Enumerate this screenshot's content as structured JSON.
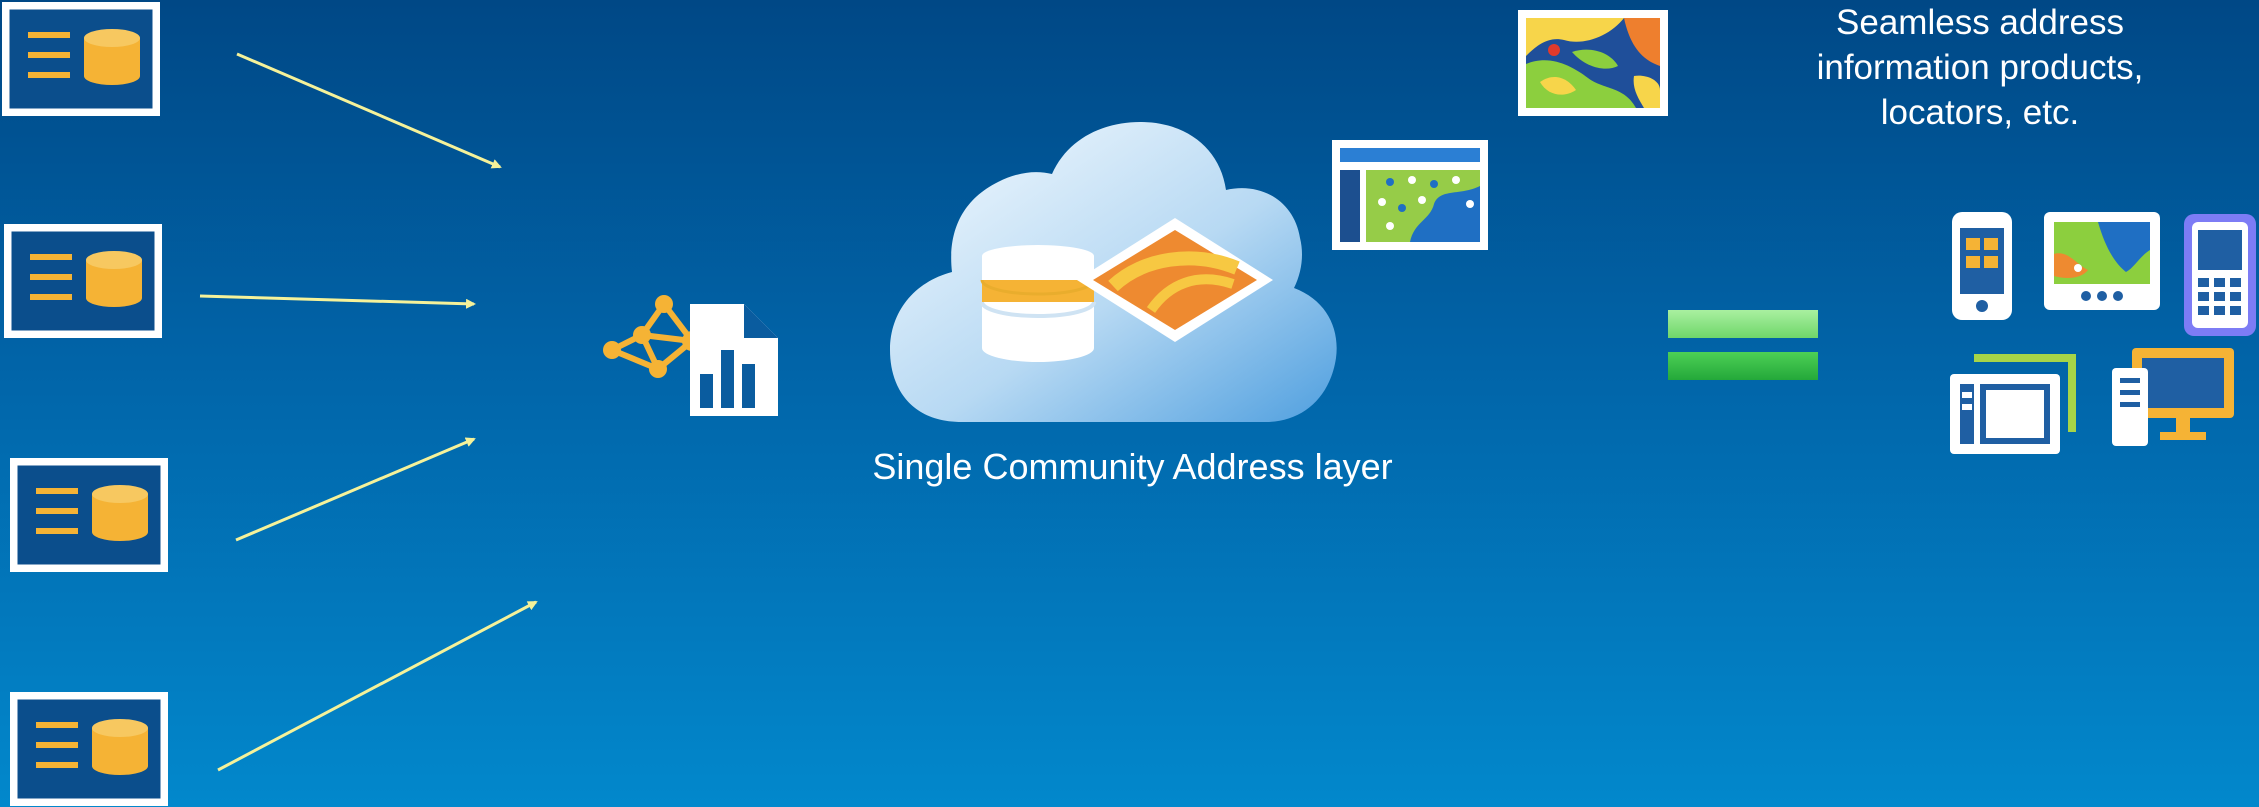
{
  "diagram": {
    "center_label": "Single Community Address layer",
    "output_label_lines": [
      "Seamless address",
      "information products,",
      "locators, etc."
    ]
  },
  "colors": {
    "background_top": "#004886",
    "background_bottom": "#0288cc",
    "arrow": "#f5f29a",
    "accent_yellow": "#f5b335",
    "equals_green": "#3cc24a"
  },
  "icons": {
    "sources": [
      "database-table-icon",
      "database-table-icon",
      "database-table-icon",
      "database-table-icon"
    ],
    "process": [
      "network-graph-icon",
      "report-document-icon"
    ],
    "center": [
      "cloud-icon",
      "database-icon",
      "map-tile-icon"
    ],
    "maps": [
      "topographic-map-icon",
      "web-map-icon"
    ],
    "equals": "equals-icon",
    "devices": [
      "smartphone-icon",
      "tablet-map-icon",
      "handheld-device-icon",
      "laptop-tablet-icon",
      "desktop-computer-icon"
    ]
  }
}
